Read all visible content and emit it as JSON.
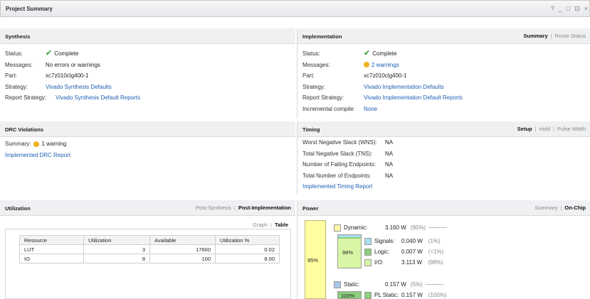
{
  "window": {
    "title": "Project Summary",
    "controls": [
      "?",
      "_",
      "□",
      "⊡",
      "×"
    ]
  },
  "synthesis": {
    "title": "Synthesis",
    "rows": [
      {
        "key": "Status:",
        "value": "Complete",
        "kind": "check"
      },
      {
        "key": "Messages:",
        "value": "No errors or warnings",
        "kind": "text"
      },
      {
        "key": "Part:",
        "value": "xc7z010clg400-1",
        "kind": "text"
      },
      {
        "key": "Strategy:",
        "value": "Vivado Synthesis Defaults",
        "kind": "link"
      },
      {
        "key": "Report Strategy:",
        "value": "Vivado Synthesis Default Reports",
        "kind": "link"
      }
    ]
  },
  "implementation": {
    "title": "Implementation",
    "tabs": [
      "Summary",
      "Route Status"
    ],
    "rows": [
      {
        "key": "Status:",
        "value": "Complete",
        "kind": "check"
      },
      {
        "key": "Messages:",
        "value": "2 warnings",
        "kind": "warn"
      },
      {
        "key": "Part:",
        "value": "xc7z010clg400-1",
        "kind": "text"
      },
      {
        "key": "Strategy:",
        "value": "Vivado Implementation Defaults",
        "kind": "link"
      },
      {
        "key": "Report Strategy:",
        "value": "Vivado Implementation Default Reports",
        "kind": "link"
      },
      {
        "key": "Incremental compile:",
        "value": "None",
        "kind": "link"
      }
    ]
  },
  "drc": {
    "title": "DRC Violations",
    "summary_key": "Summary:",
    "summary_value": "1 warning",
    "report_link": "Implemented DRC Report"
  },
  "timing": {
    "title": "Timing",
    "tabs": [
      "Setup",
      "Hold",
      "Pulse Width"
    ],
    "rows": [
      {
        "key": "Worst Negative Slack (WNS):",
        "value": "NA"
      },
      {
        "key": "Total Negative Slack (TNS):",
        "value": "NA"
      },
      {
        "key": "Number of Failing Endpoints:",
        "value": "NA"
      },
      {
        "key": "Total Number of Endpoints:",
        "value": "NA"
      }
    ],
    "report_link": "Implemented Timing Report"
  },
  "utilization": {
    "title": "Utilization",
    "tabs": [
      "Post-Synthesis",
      "Post-Implementation"
    ],
    "view_tabs": [
      "Graph",
      "Table"
    ],
    "columns": [
      "Resource",
      "Utilization",
      "Available",
      "Utilization %"
    ],
    "rows": [
      [
        "LUT",
        "3",
        "17600",
        "0.02"
      ],
      [
        "IO",
        "8",
        "100",
        "8.00"
      ]
    ]
  },
  "power": {
    "title": "Power",
    "tabs": [
      "Summary",
      "On-Chip"
    ],
    "total_pct": "95%",
    "dynamic": {
      "label": "Dynamic:",
      "value": "3.160 W",
      "pct": "(95%)",
      "bar_pct": "98%"
    },
    "breakdown": [
      {
        "label": "Signals:",
        "value": "0.040 W",
        "pct": "(1%)",
        "color": "#a9dff0"
      },
      {
        "label": "Logic:",
        "value": "0.007 W",
        "pct": "(<1%)",
        "color": "#8ccf7d"
      },
      {
        "label": "I/O:",
        "value": "3.113 W",
        "pct": "(98%)",
        "color": "#d9f5a6"
      }
    ],
    "static": {
      "label": "Static:",
      "value": "0.157 W",
      "pct": "(5%)",
      "bar_pct": "100%"
    },
    "static_breakdown": [
      {
        "label": "PL Static:",
        "value": "0.157 W",
        "pct": "(100%)",
        "color": "#8ccf7d"
      }
    ],
    "colors": {
      "total": "#fffda0",
      "dynamic": "#fff6a8",
      "static": "#a9c8ec"
    }
  }
}
